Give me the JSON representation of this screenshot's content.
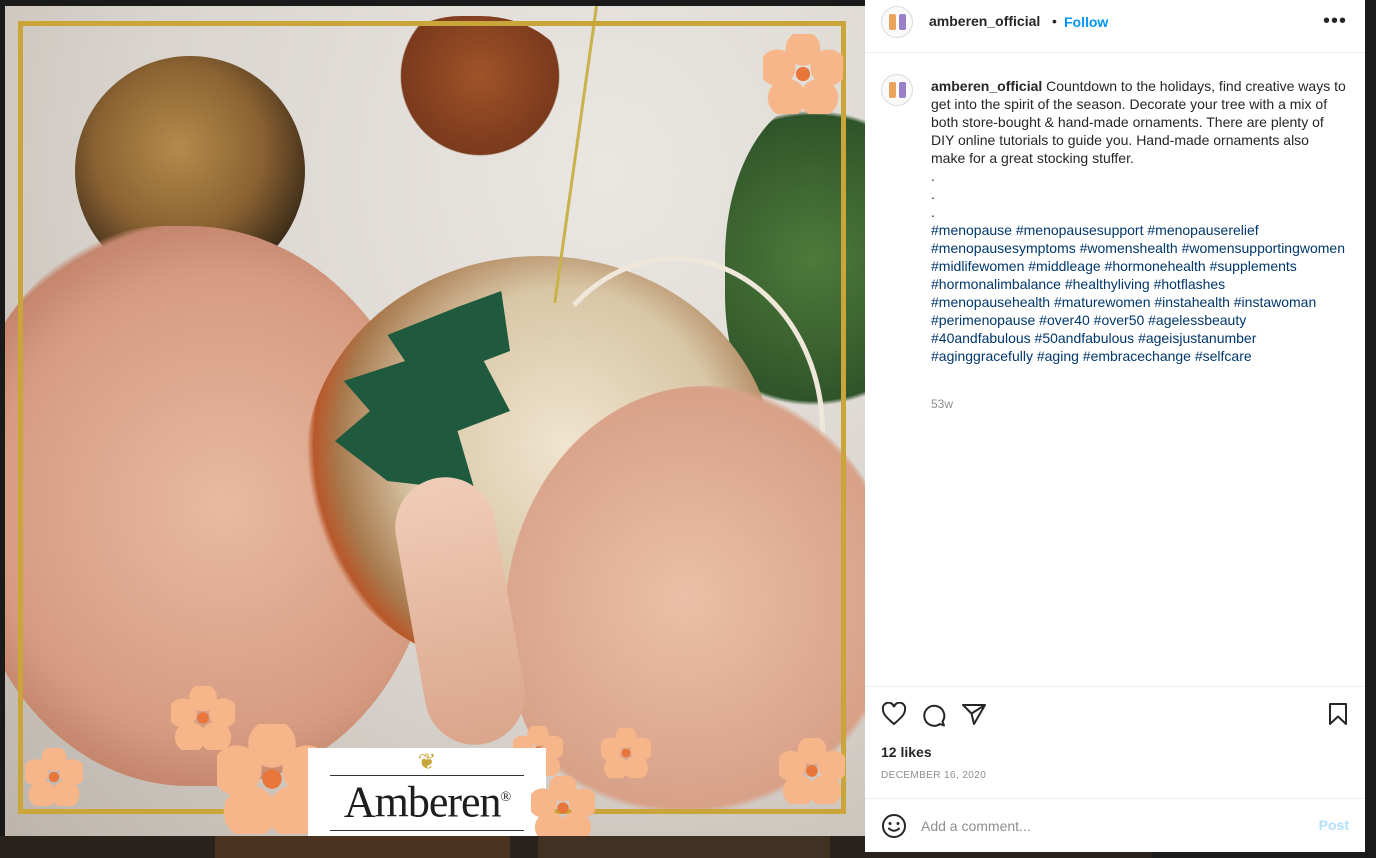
{
  "post": {
    "username": "amberen_official",
    "follow_label": "Follow",
    "separator": "•",
    "more_label": "•••",
    "caption_text": "Countdown to the holidays, find creative ways to get into the spirit of the season. Decorate your tree with a mix of both store-bought & hand-made ornaments. There are plenty of DIY online tutorials to guide you. Hand-made ornaments also make for a great stocking stuffer.\n.\n.\n.\n",
    "hashtags": "#menopause #menopausesupport #menopauserelief #menopausesymptoms #womenshealth #womensupportingwomen #midlifewomen #middleage #hormonehealth #supplements #hormonalimbalance #healthyliving #hotflashes #menopausehealth #maturewomen #instahealth #instawoman #perimenopause #over40 #over50 #agelessbeauty #40andfabulous #50andfabulous #ageisjustanumber #aginggracefully #aging #embracechange #selfcare",
    "time_ago": "53w",
    "likes": "12 likes",
    "date": "DECEMBER 16, 2020"
  },
  "media": {
    "logo_text": "Amberen",
    "logo_mark": "❦",
    "registered": "®"
  },
  "comment": {
    "placeholder": "Add a comment...",
    "post_label": "Post"
  },
  "icons": {
    "like": "heart-icon",
    "comment": "speech-bubble-icon",
    "share": "paper-plane-icon",
    "save": "bookmark-icon",
    "emoji": "smiley-icon",
    "more": "ellipsis-icon"
  },
  "colors": {
    "link_blue": "#0095f6",
    "hashtag_blue": "#00376b",
    "frame_gold": "#c9a53a",
    "post_disabled": "#b2dffc"
  }
}
